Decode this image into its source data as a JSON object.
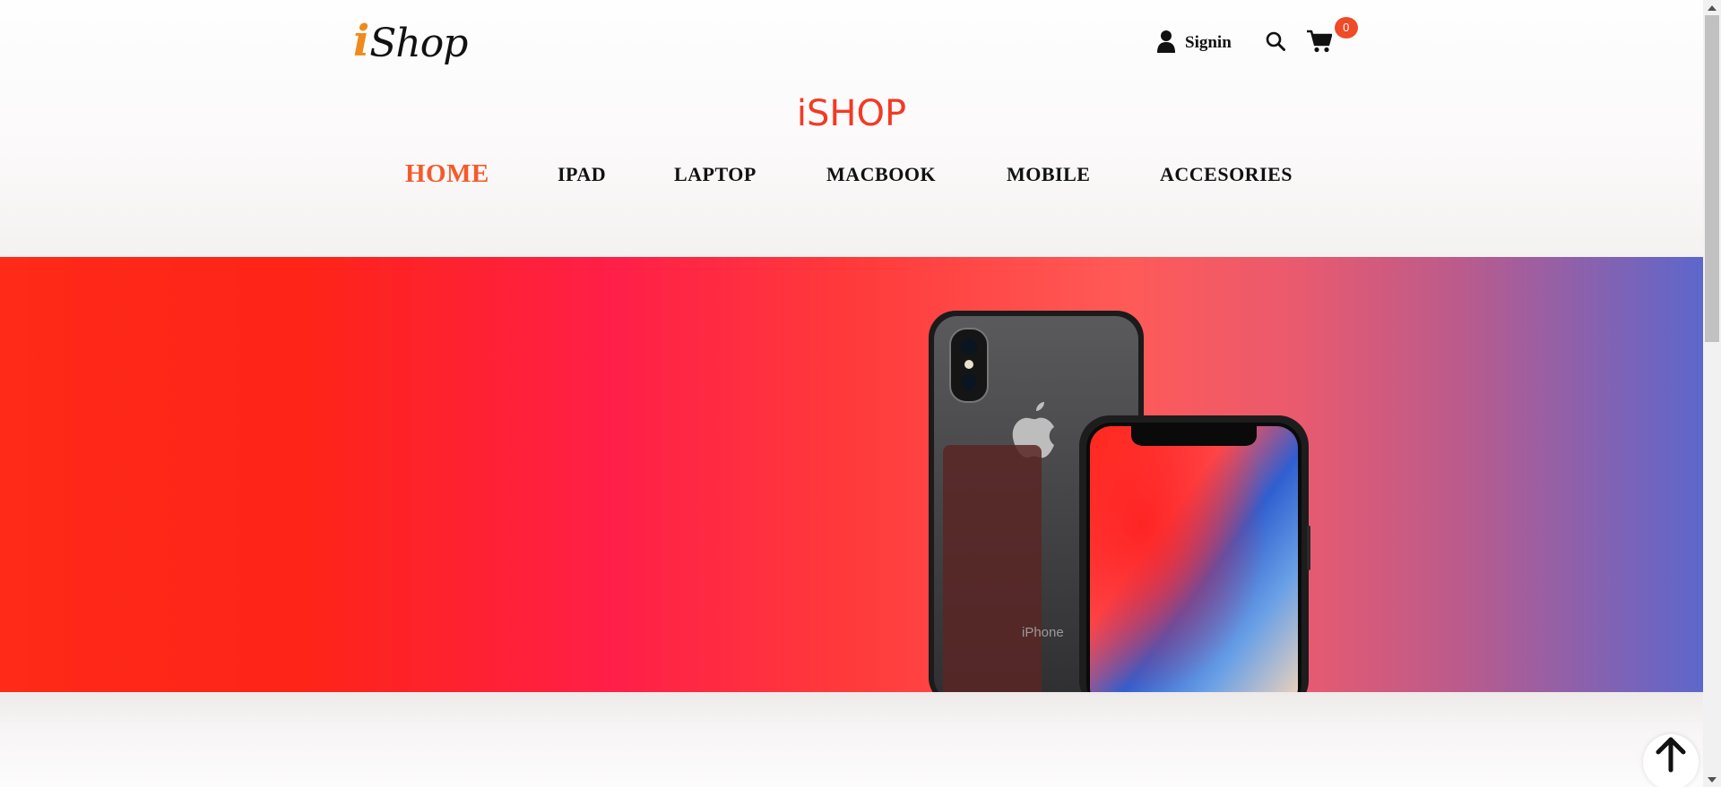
{
  "header": {
    "logo": {
      "first_letter": "i",
      "rest": "Shop"
    },
    "signin_label": "Signin",
    "cart_count": "0",
    "brand_title": "iSHOP"
  },
  "nav": {
    "items": [
      {
        "label": "HOME",
        "active": true
      },
      {
        "label": "IPAD",
        "active": false
      },
      {
        "label": "LAPTOP",
        "active": false
      },
      {
        "label": "MACBOOK",
        "active": false
      },
      {
        "label": "MOBILE",
        "active": false
      },
      {
        "label": "ACCESORIES",
        "active": false
      }
    ]
  },
  "hero": {
    "product_label": "iPhone",
    "image_subject": "iPhone X front and back"
  },
  "icons": {
    "user": "user-icon",
    "search": "search-icon",
    "cart": "cart-icon",
    "back_to_top": "arrow-up-icon"
  },
  "colors": {
    "accent": "#f55a2c",
    "brand_title": "#f23a25",
    "badge": "#f04a27",
    "logo_i": "#f08a1c",
    "hero_left": "#ff2a18",
    "hero_mid": "#ff1f48",
    "hero_right": "#5d67cc"
  }
}
